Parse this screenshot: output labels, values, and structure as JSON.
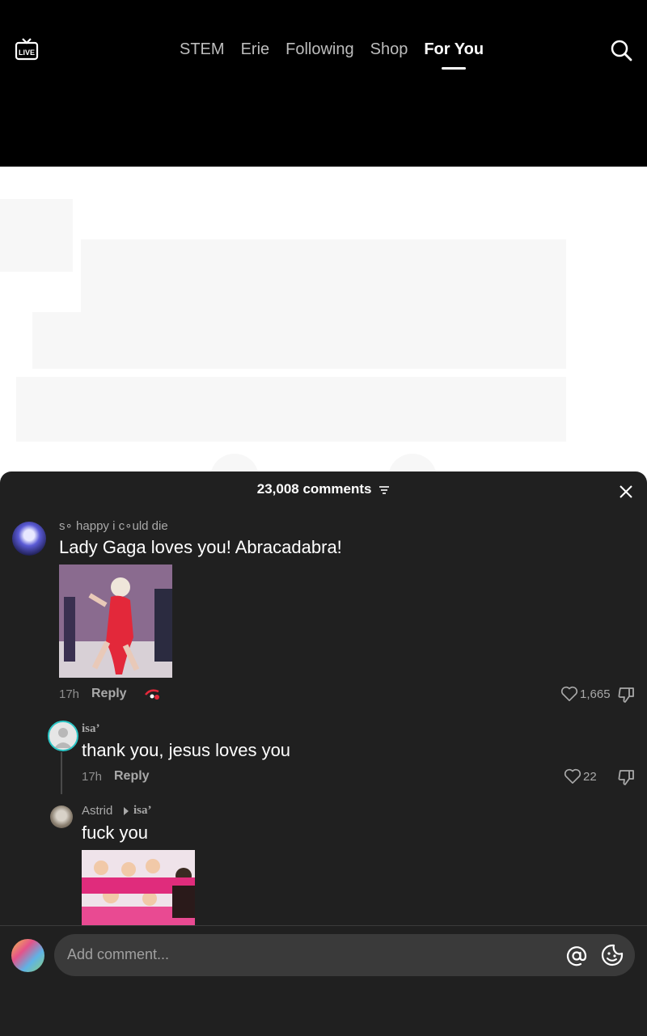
{
  "nav": {
    "tabs": [
      "STEM",
      "Erie",
      "Following",
      "Shop",
      "For You"
    ],
    "active_tab": "For You",
    "live_icon": "live-tv-icon",
    "search_icon": "search-icon"
  },
  "comments_panel": {
    "count_label": "23,008 comments",
    "close_icon": "close-icon",
    "comments": [
      {
        "username": "s∘ happy i c∘uld die",
        "text": "Lady Gaga loves you! Abracadabra!",
        "time": "17h",
        "reply_label": "Reply",
        "likes": "1,665",
        "has_image": true
      },
      {
        "username": "isa’",
        "text": "thank you, jesus loves you",
        "time": "17h",
        "reply_label": "Reply",
        "likes": "22"
      },
      {
        "username": "Astrid",
        "reply_to": "isa’",
        "text": "fuck you",
        "has_image": true
      }
    ]
  },
  "composer": {
    "placeholder": "Add comment...",
    "at_icon": "at-mention-icon",
    "emoji_icon": "emoji-icon"
  },
  "colors": {
    "sheet_bg": "#202020",
    "topbar_bg": "#000000",
    "accent_red": "#e3283a"
  }
}
